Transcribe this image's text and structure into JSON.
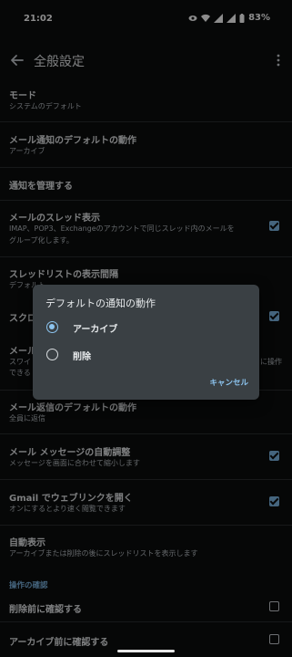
{
  "status_bar": {
    "time": "21:02",
    "battery": "83%",
    "icons": [
      "eye-icon",
      "wifi-icon",
      "signal-icon",
      "signal-icon",
      "battery-icon"
    ]
  },
  "app_bar": {
    "title": "全般設定",
    "back_icon": "arrow-left-icon",
    "menu_icon": "more-vert-icon"
  },
  "settings": [
    {
      "title": "モード",
      "subtitle": "システムのデフォルト",
      "checkbox": null
    },
    {
      "title": "メール通知のデフォルトの動作",
      "subtitle": "アーカイブ",
      "checkbox": null
    },
    {
      "title": "通知を管理する",
      "subtitle": "",
      "checkbox": null
    },
    {
      "title": "メールのスレッド表示",
      "subtitle": "IMAP、POP3、Exchangeのアカウントで同じスレッド内のメールを",
      "subtitle2": "グループ化します。",
      "checkbox": true
    },
    {
      "title": "スレッドリストの表示間隔",
      "subtitle": "デフォルト",
      "checkbox": null
    },
    {
      "title": "スクロ",
      "subtitle": "",
      "checkbox": true
    },
    {
      "title": "メール",
      "subtitle": "スワイ",
      "subtitle_right": "に操作",
      "subtitle2": "できる",
      "checkbox": null
    },
    {
      "title": "メール返信のデフォルトの動作",
      "subtitle": "全員に返信",
      "checkbox": null
    },
    {
      "title": "メール メッセージの自動調整",
      "subtitle": "メッセージを画面に合わせて縮小します",
      "checkbox": true
    },
    {
      "title": "Gmail でウェブリンクを開く",
      "subtitle": "オンにするとより速く閲覧できます",
      "checkbox": true
    },
    {
      "title": "自動表示",
      "subtitle": "アーカイブまたは削除の後にスレッドリストを表示します",
      "checkbox": null
    }
  ],
  "confirm_section": {
    "header": "操作の確認",
    "items": [
      {
        "title": "削除前に確認する",
        "checkbox": false
      },
      {
        "title": "アーカイブ前に確認する",
        "checkbox": false
      }
    ]
  },
  "dialog": {
    "title": "デフォルトの通知の動作",
    "options": [
      {
        "label": "アーカイブ",
        "selected": true
      },
      {
        "label": "削除",
        "selected": false
      }
    ],
    "cancel": "キャンセル"
  },
  "colors": {
    "background": "#0b0d0e",
    "accent": "#7fb8e6",
    "dialog_bg": "#3a4044"
  }
}
